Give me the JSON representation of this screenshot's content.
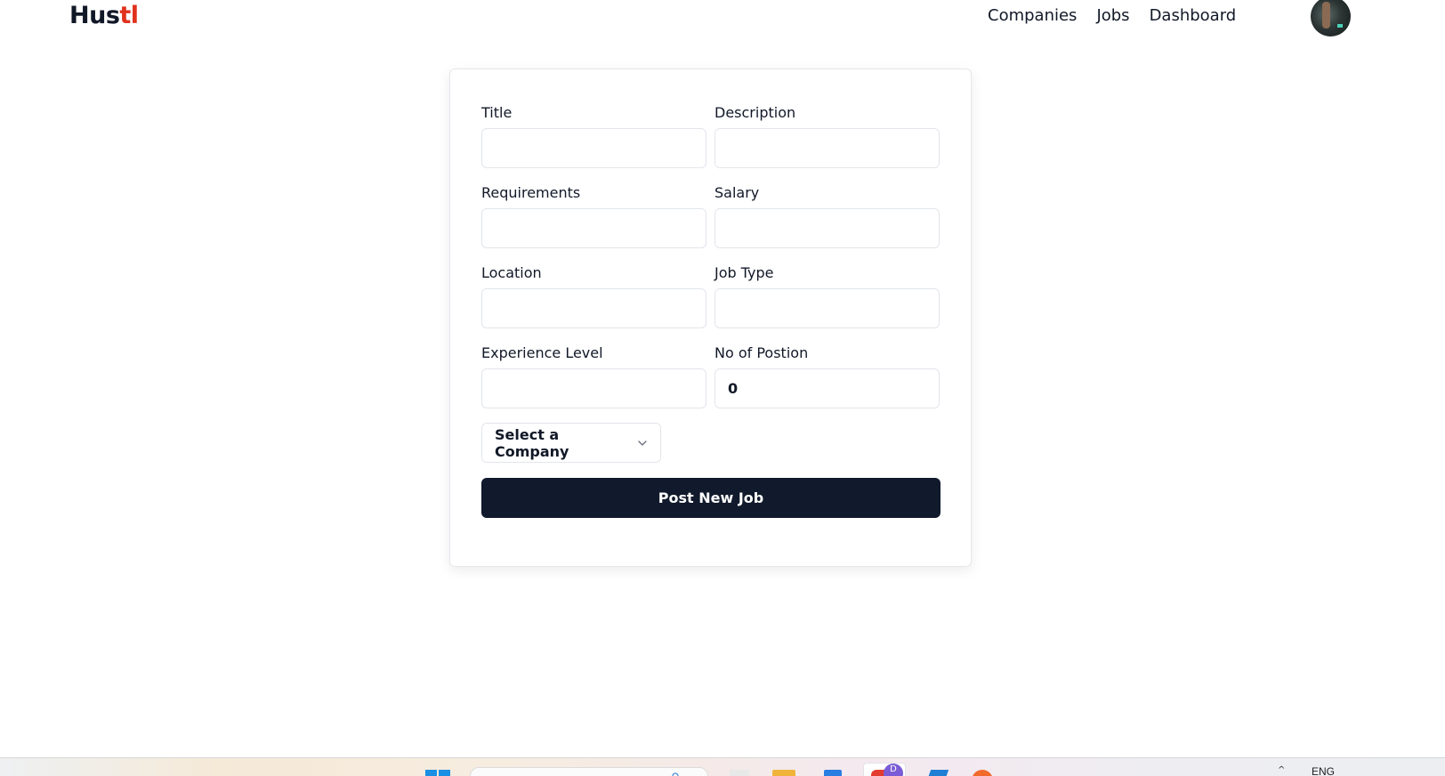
{
  "navbar": {
    "logo_main": "Hus",
    "logo_accent": "tl",
    "links": [
      "Companies",
      "Jobs",
      "Dashboard"
    ],
    "avatar_alt": "user-avatar"
  },
  "form": {
    "fields": [
      {
        "label": "Title",
        "value": ""
      },
      {
        "label": "Description",
        "value": ""
      },
      {
        "label": "Requirements",
        "value": ""
      },
      {
        "label": "Salary",
        "value": ""
      },
      {
        "label": "Location",
        "value": ""
      },
      {
        "label": "Job Type",
        "value": ""
      },
      {
        "label": "Experience Level",
        "value": ""
      },
      {
        "label": "No of Postion",
        "value": "0"
      }
    ],
    "company_select": "Select a Company",
    "submit_label": "Post New Job"
  },
  "taskbar": {
    "language": "ENG",
    "badge": "D"
  },
  "colors": {
    "accent": "#e0321c",
    "button_bg": "#111a2c"
  }
}
